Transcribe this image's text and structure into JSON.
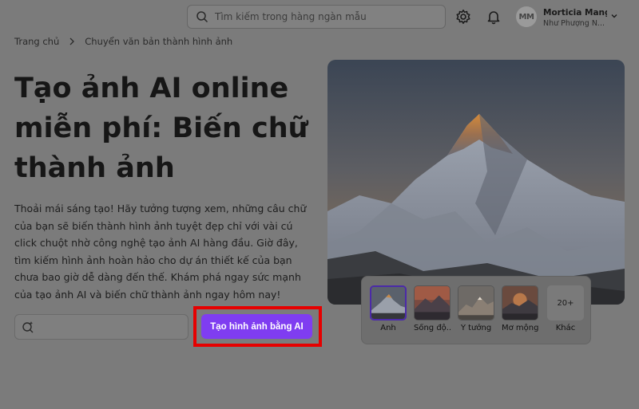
{
  "header": {
    "search_placeholder": "Tìm kiếm trong hàng ngàn mẫu",
    "avatar_initials": "MM",
    "user_name": "Morticia Mang...",
    "user_org": "Như Phượng N..."
  },
  "breadcrumb": {
    "home": "Trang chủ",
    "current": "Chuyển văn bản thành hình ảnh"
  },
  "hero": {
    "title": "Tạo ảnh AI online miễn phí: Biến chữ thành ảnh",
    "description": "Thoải mái sáng tạo! Hãy tưởng tượng xem, những câu chữ của bạn sẽ biến thành hình ảnh tuyệt đẹp chỉ với vài cú click chuột nhờ công nghệ tạo ảnh AI hàng đầu. Giờ đây, tìm kiếm hình ảnh hoàn hảo cho dự án thiết kế của bạn chưa bao giờ dễ dàng đến thế. Khám phá ngay sức mạnh của tạo ảnh AI và biến chữ thành ảnh ngay hôm nay!",
    "cta_label": "Tạo hình ảnh bằng AI"
  },
  "styles": {
    "items": [
      {
        "label": "Ảnh"
      },
      {
        "label": "Sống độ..."
      },
      {
        "label": "Ý tưởng"
      },
      {
        "label": "Mơ mộng"
      }
    ],
    "more_count": "20+",
    "more_label": "Khác"
  },
  "colors": {
    "accent": "#7f3df1",
    "highlight": "#e60000"
  }
}
